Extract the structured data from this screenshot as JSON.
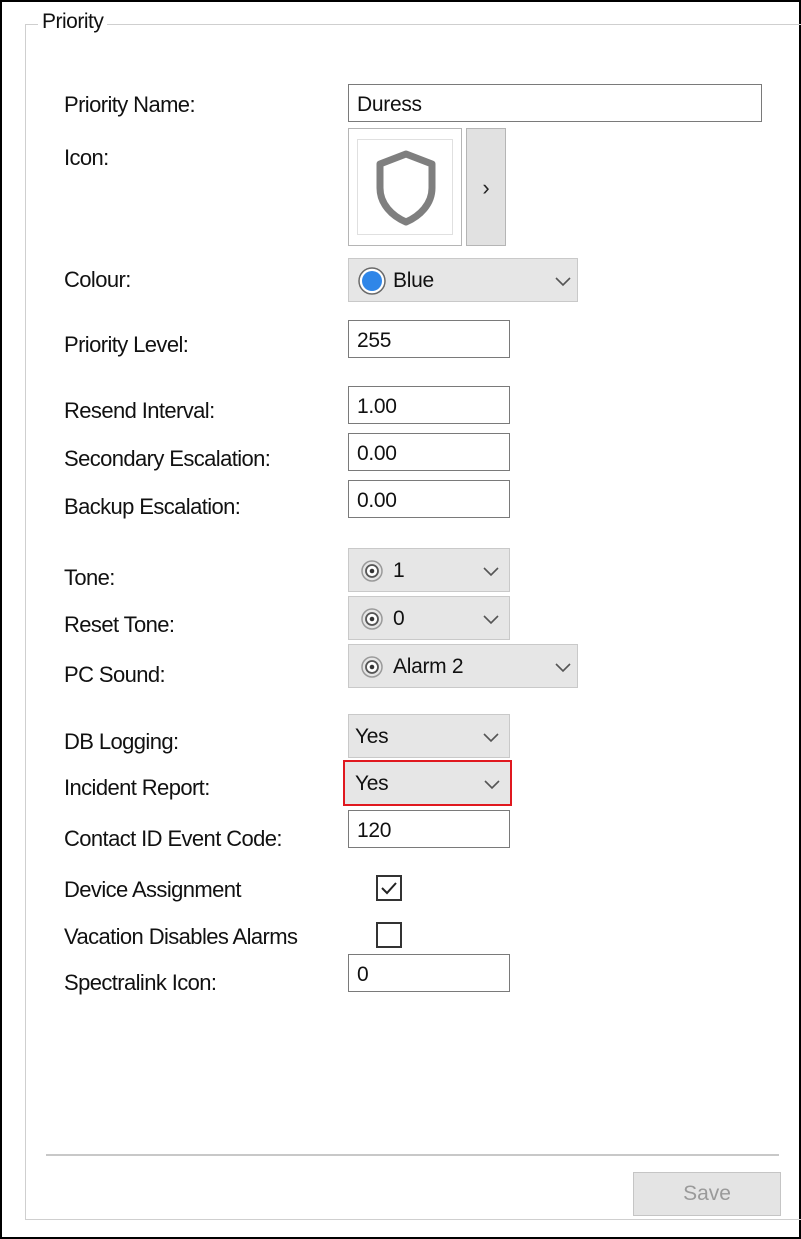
{
  "groupbox": {
    "title": "Priority"
  },
  "fields": {
    "priority_name": {
      "label": "Priority Name:",
      "value": "Duress"
    },
    "icon": {
      "label": "Icon:",
      "icon_name": "shield-icon",
      "button_label": "›"
    },
    "colour": {
      "label": "Colour:",
      "value": "Blue",
      "swatch": "#2f86e8"
    },
    "priority_level": {
      "label": "Priority Level:",
      "value": "255"
    },
    "resend_interval": {
      "label": "Resend Interval:",
      "value": "1.00"
    },
    "secondary_escalation": {
      "label": "Secondary Escalation:",
      "value": "0.00"
    },
    "backup_escalation": {
      "label": "Backup Escalation:",
      "value": "0.00"
    },
    "tone": {
      "label": "Tone:",
      "value": "1"
    },
    "reset_tone": {
      "label": "Reset Tone:",
      "value": "0"
    },
    "pc_sound": {
      "label": "PC Sound:",
      "value": "Alarm 2"
    },
    "db_logging": {
      "label": "DB Logging:",
      "value": "Yes"
    },
    "incident_report": {
      "label": "Incident Report:",
      "value": "Yes",
      "highlight_color": "#e0181f"
    },
    "contact_id": {
      "label": "Contact ID Event Code:",
      "value": "120"
    },
    "device_assignment": {
      "label": "Device Assignment",
      "checked": true
    },
    "vacation_disables": {
      "label": "Vacation Disables Alarms",
      "checked": false
    },
    "spectralink_icon": {
      "label": "Spectralink Icon:",
      "value": "0"
    }
  },
  "footer": {
    "save_label": "Save"
  }
}
